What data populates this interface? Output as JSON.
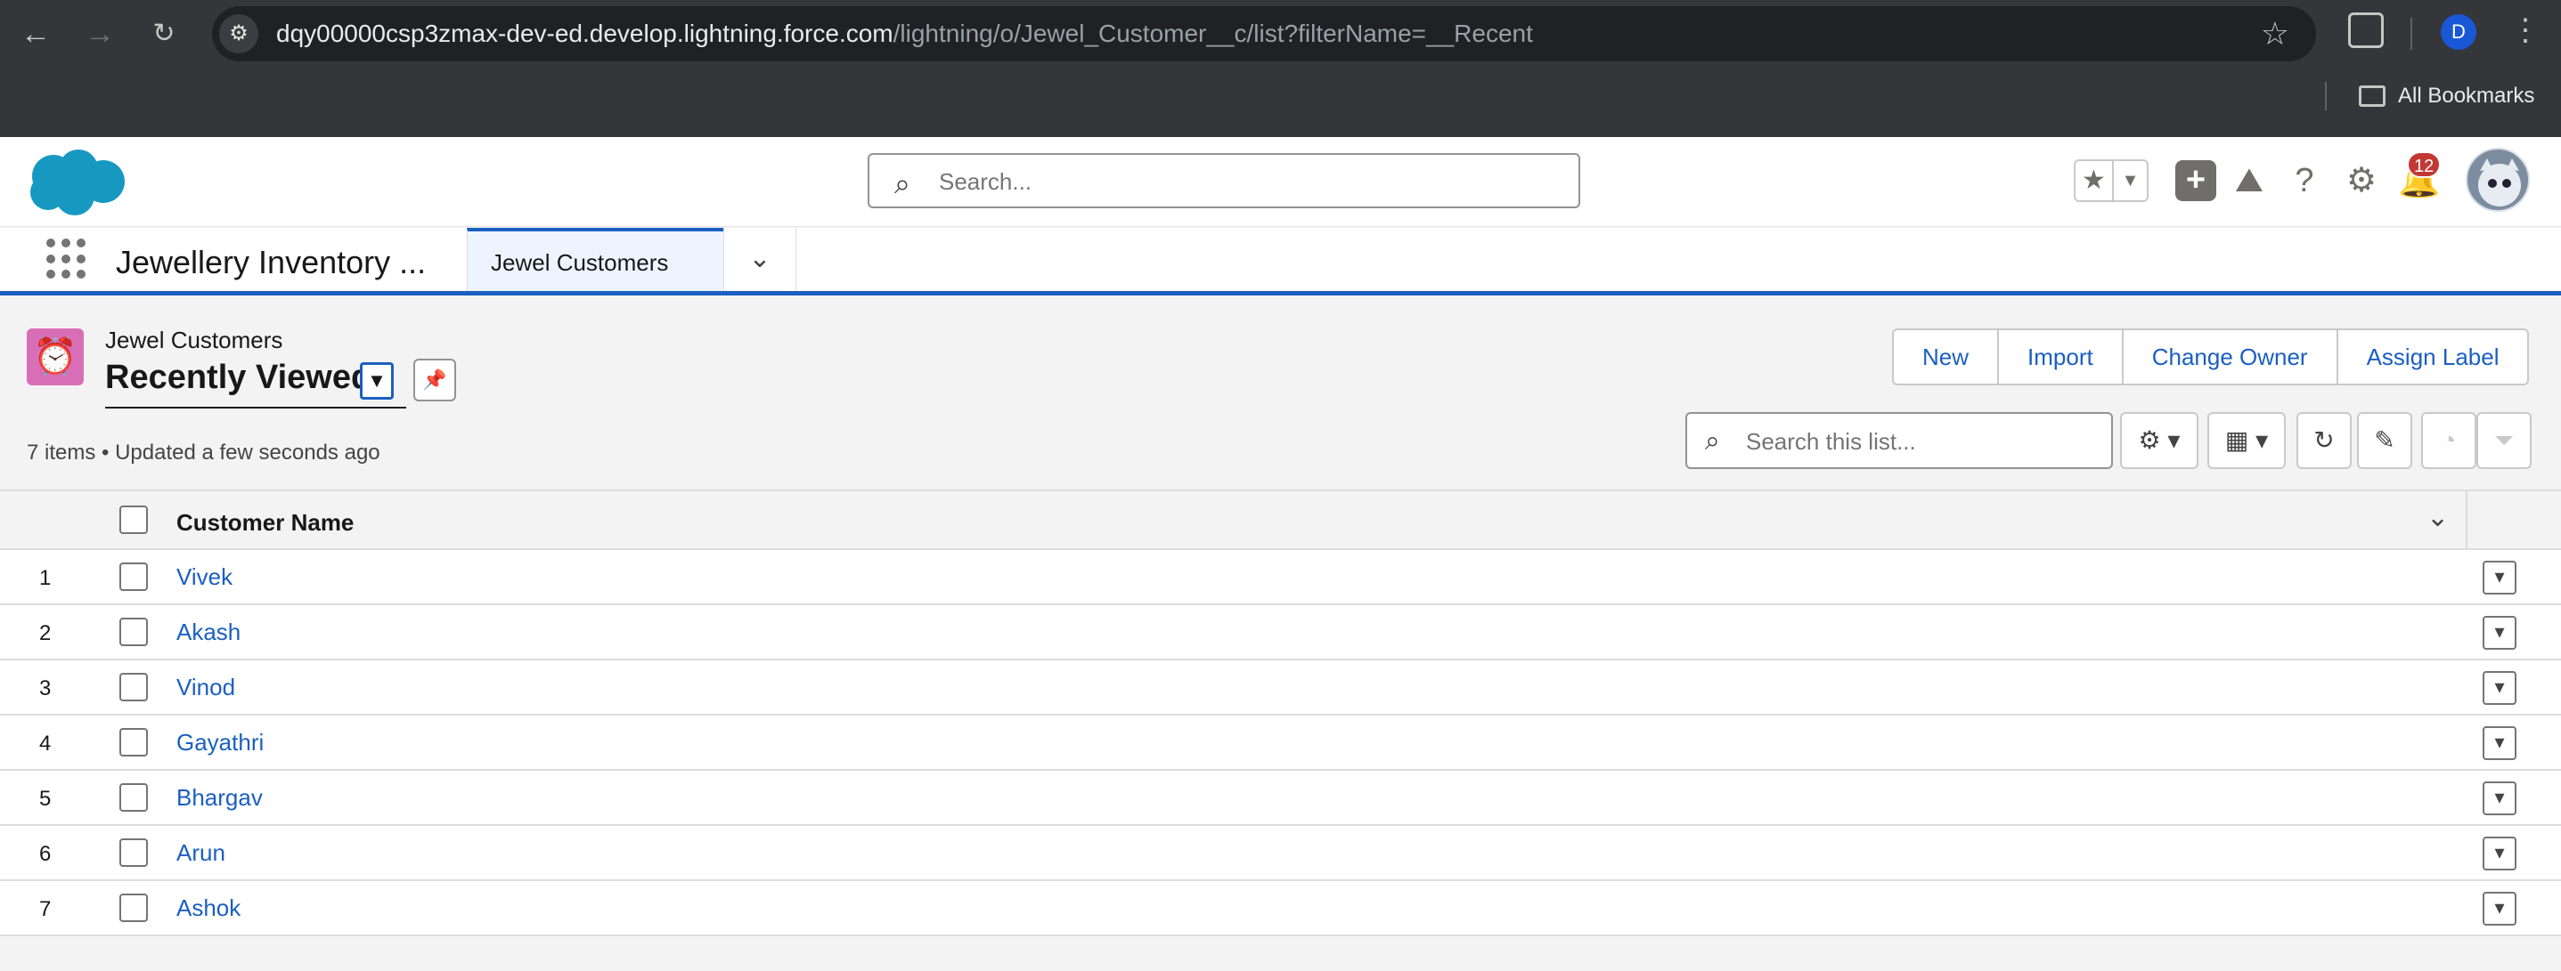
{
  "browser": {
    "url_host": "dqy00000csp3zmax-dev-ed.develop.lightning.force.com",
    "url_path": "/lightning/o/Jewel_Customer__c/list?filterName=__Recent",
    "profile_initial": "D",
    "bookmarks_label": "All Bookmarks"
  },
  "header": {
    "search_placeholder": "Search...",
    "notification_count": "12"
  },
  "app_nav": {
    "app_name": "Jewellery Inventory ...",
    "active_tab": "Jewel Customers"
  },
  "list": {
    "object_label": "Jewel Customers",
    "view_name": "Recently Viewed",
    "meta": "7 items • Updated a few seconds ago",
    "actions": [
      "New",
      "Import",
      "Change Owner",
      "Assign Label"
    ],
    "search_placeholder": "Search this list..."
  },
  "table": {
    "column": "Customer Name",
    "rows": [
      {
        "num": "1",
        "name": "Vivek"
      },
      {
        "num": "2",
        "name": "Akash"
      },
      {
        "num": "3",
        "name": "Vinod"
      },
      {
        "num": "4",
        "name": "Gayathri"
      },
      {
        "num": "5",
        "name": "Bhargav"
      },
      {
        "num": "6",
        "name": "Arun"
      },
      {
        "num": "7",
        "name": "Ashok"
      }
    ]
  },
  "colors": {
    "brand": "#1b5fc1",
    "object_icon": "#d86fb6",
    "badge": "#c23934"
  }
}
